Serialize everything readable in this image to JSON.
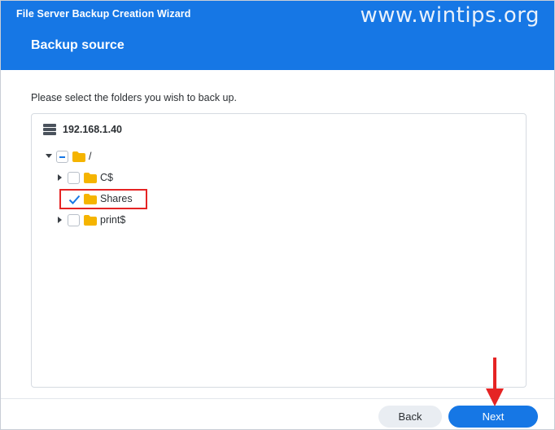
{
  "window": {
    "title": "File Server Backup Creation Wizard",
    "watermark": "www.wintips.org"
  },
  "step": {
    "title": "Backup source",
    "instruction": "Please select the folders you wish to back up."
  },
  "tree": {
    "server": "192.168.1.40",
    "root": {
      "label": "/",
      "state": "partial",
      "expanded": true
    },
    "children": [
      {
        "label": "C$",
        "checked": false,
        "expandable": true
      },
      {
        "label": "Shares",
        "checked": true,
        "expandable": false
      },
      {
        "label": "print$",
        "checked": false,
        "expandable": true
      }
    ]
  },
  "buttons": {
    "back": "Back",
    "next": "Next"
  },
  "colors": {
    "accent": "#1677e5",
    "folder": "#f5b400",
    "highlight": "#e52424"
  },
  "icons": [
    "server-icon",
    "folder-icon",
    "caret-down-icon",
    "caret-right-icon",
    "checkmark-icon",
    "arrow-down-icon"
  ]
}
